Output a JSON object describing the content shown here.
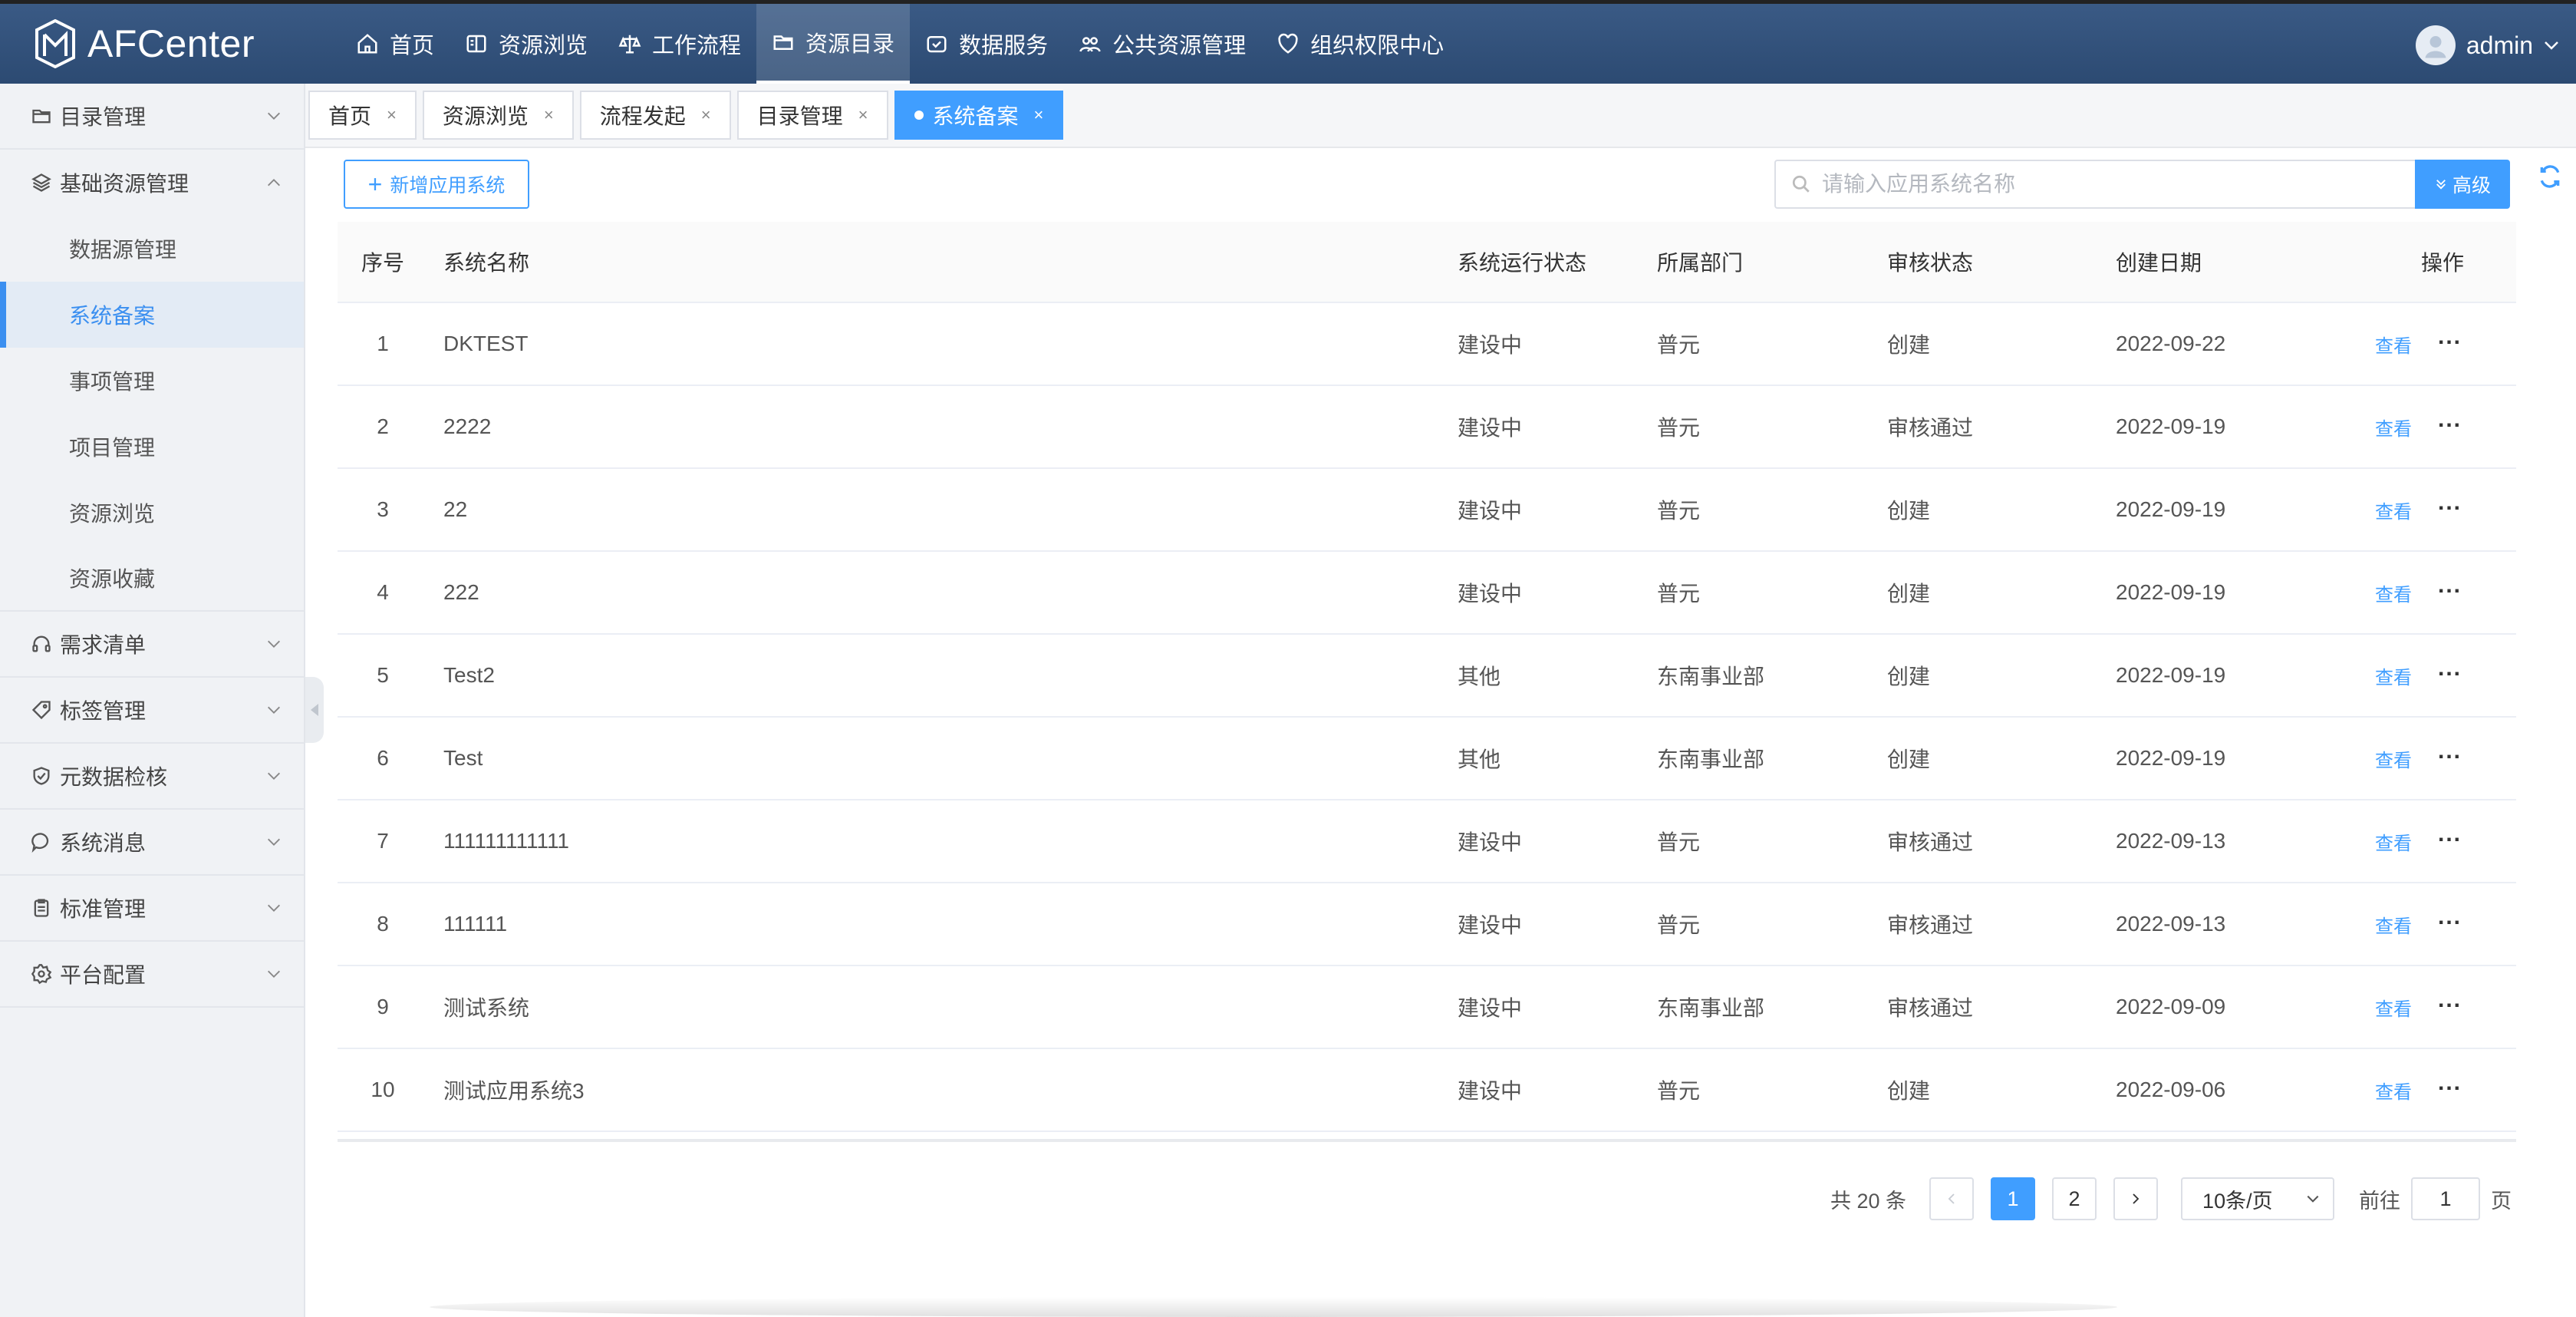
{
  "app": {
    "name": "AFCenter"
  },
  "nav": [
    {
      "label": "首页",
      "icon": "home-icon"
    },
    {
      "label": "资源浏览",
      "icon": "book-icon"
    },
    {
      "label": "工作流程",
      "icon": "scale-icon"
    },
    {
      "label": "资源目录",
      "icon": "folder-icon",
      "active": true
    },
    {
      "label": "数据服务",
      "icon": "box-icon"
    },
    {
      "label": "公共资源管理",
      "icon": "share-icon"
    },
    {
      "label": "组织权限中心",
      "icon": "shield-heart-icon"
    }
  ],
  "user": {
    "name": "admin"
  },
  "sidebar": {
    "groups": [
      {
        "label": "目录管理",
        "icon": "folder-icon"
      },
      {
        "label": "基础资源管理",
        "icon": "layers-icon",
        "expanded": true,
        "items": [
          {
            "label": "数据源管理"
          },
          {
            "label": "系统备案",
            "active": true
          },
          {
            "label": "事项管理"
          },
          {
            "label": "项目管理"
          },
          {
            "label": "资源浏览"
          },
          {
            "label": "资源收藏"
          }
        ]
      },
      {
        "label": "需求清单",
        "icon": "headset-icon"
      },
      {
        "label": "标签管理",
        "icon": "tag-icon"
      },
      {
        "label": "元数据检核",
        "icon": "shield-check-icon"
      },
      {
        "label": "系统消息",
        "icon": "chat-icon"
      },
      {
        "label": "标准管理",
        "icon": "clipboard-icon"
      },
      {
        "label": "平台配置",
        "icon": "gear-icon"
      }
    ]
  },
  "tabs": [
    {
      "label": "首页",
      "close": "×"
    },
    {
      "label": "资源浏览",
      "close": "×"
    },
    {
      "label": "流程发起",
      "close": "×"
    },
    {
      "label": "目录管理",
      "close": "×"
    },
    {
      "label": "系统备案",
      "close": "×",
      "active": true
    }
  ],
  "toolbar": {
    "add_label": "新增应用系统",
    "add_plus": "+",
    "search_placeholder": "请输入应用系统名称",
    "advanced_label": "高级"
  },
  "table": {
    "headers": [
      "序号",
      "系统名称",
      "系统运行状态",
      "所属部门",
      "审核状态",
      "创建日期",
      "操作"
    ],
    "view_label": "查看",
    "more_label": "...",
    "rows": [
      [
        "1",
        "DKTEST",
        "建设中",
        "普元",
        "创建",
        "2022-09-22"
      ],
      [
        "2",
        "2222",
        "建设中",
        "普元",
        "审核通过",
        "2022-09-19"
      ],
      [
        "3",
        "22",
        "建设中",
        "普元",
        "创建",
        "2022-09-19"
      ],
      [
        "4",
        "222",
        "建设中",
        "普元",
        "创建",
        "2022-09-19"
      ],
      [
        "5",
        "Test2",
        "其他",
        "东南事业部",
        "创建",
        "2022-09-19"
      ],
      [
        "6",
        "Test",
        "其他",
        "东南事业部",
        "创建",
        "2022-09-19"
      ],
      [
        "7",
        "111111111111",
        "建设中",
        "普元",
        "审核通过",
        "2022-09-13"
      ],
      [
        "8",
        "111111",
        "建设中",
        "普元",
        "审核通过",
        "2022-09-13"
      ],
      [
        "9",
        "测试系统",
        "建设中",
        "东南事业部",
        "审核通过",
        "2022-09-09"
      ],
      [
        "10",
        "测试应用系统3",
        "建设中",
        "普元",
        "创建",
        "2022-09-06"
      ]
    ]
  },
  "pagination": {
    "total_label": "共 20 条",
    "pages": [
      "1",
      "2"
    ],
    "current": "1",
    "page_size": "10条/页",
    "goto_prefix": "前往",
    "goto_value": "1",
    "goto_suffix": "页"
  },
  "colors": {
    "primary": "#409eff",
    "header": "#2f4e77"
  }
}
